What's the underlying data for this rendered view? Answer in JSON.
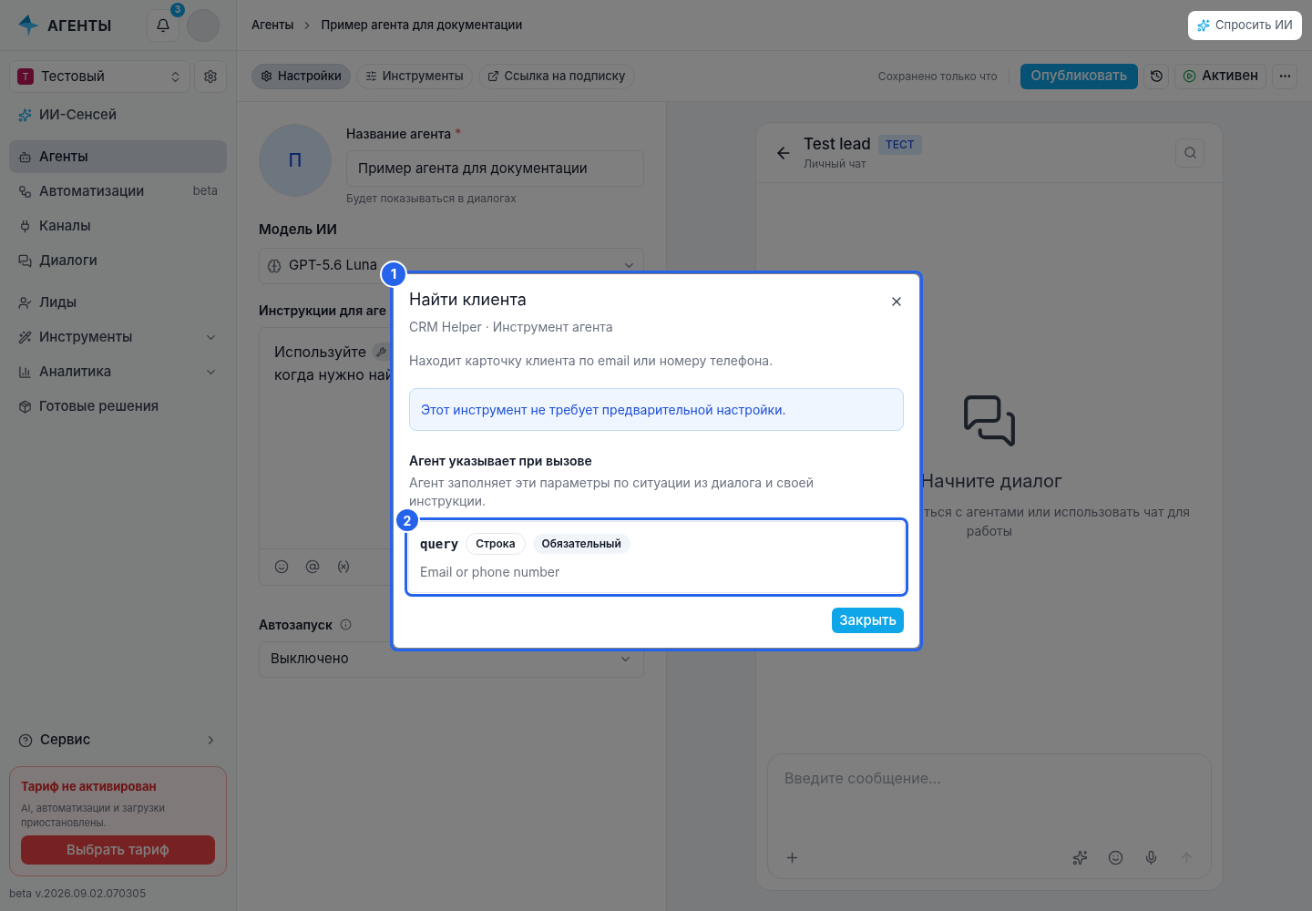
{
  "app": {
    "logo": "АГЕНТЫ",
    "notifications": "3"
  },
  "workspace": {
    "name": "Тестовый",
    "initial": "Т"
  },
  "sidebar": {
    "nav_groups": [
      {
        "items": [
          {
            "label": "ИИ-Сенсей",
            "kind": "ai",
            "selected": false
          }
        ]
      },
      {
        "items": [
          {
            "label": "Агенты",
            "kind": "agents",
            "selected": true
          },
          {
            "label": "Автоматизации",
            "kind": "automations",
            "selected": false,
            "badge": "beta"
          },
          {
            "label": "Каналы",
            "kind": "channels",
            "selected": false
          },
          {
            "label": "Диалоги",
            "kind": "dialogs",
            "selected": false
          }
        ]
      },
      {
        "items": [
          {
            "label": "Лиды",
            "kind": "leads",
            "selected": false
          },
          {
            "label": "Инструменты",
            "kind": "tools",
            "selected": false,
            "expandable": true
          },
          {
            "label": "Аналитика",
            "kind": "analytics",
            "selected": false,
            "expandable": true
          },
          {
            "label": "Готовые решения",
            "kind": "solutions",
            "selected": false
          }
        ]
      }
    ],
    "footer_item": {
      "label": "Сервис"
    },
    "plan_notice": {
      "title": "Тариф не активирован",
      "text": "AI, автоматизации и загрузки приостановлены.",
      "button": "Выбрать тариф"
    },
    "version": "beta v.2026.09.02.070305"
  },
  "header": {
    "breadcrumbs": [
      "Агенты",
      "Пример агента для документации"
    ],
    "ask_ai": "Спросить ИИ"
  },
  "toolbar": {
    "tabs": [
      {
        "label": "Настройки",
        "kind": "settings",
        "selected": true
      },
      {
        "label": "Инструменты",
        "kind": "tools",
        "selected": false
      },
      {
        "label": "Ссылка на подписку",
        "kind": "link",
        "selected": false
      }
    ],
    "save_status": "Сохранено только что",
    "publish": "Опубликовать",
    "status": "Активен"
  },
  "form": {
    "avatar": "П",
    "name_label": "Название агента",
    "required_mark": "*",
    "name_value": "Пример агента для документации",
    "name_hint": "Будет показываться в диалогах",
    "model_label": "Модель ИИ",
    "model_value": "GPT-5.6 Luna",
    "instructions_label": "Инструкции для аге",
    "instructions_lines": [
      "Используйте",
      "когда нужно най"
    ],
    "autostart_label": "Автозапуск",
    "autostart_value": "Выключено"
  },
  "chat": {
    "title": "Test lead",
    "tag": "ТЕСТ",
    "subtitle": "Личный чат",
    "empty_title": "Начните диалог",
    "empty_lines": [
      "ться с агентами или использовать чат для",
      "работы"
    ],
    "composer_placeholder": "Введите сообщение..."
  },
  "modal": {
    "title": "Найти клиента",
    "subtitle": "CRM Helper · Инструмент агента",
    "description": "Находит карточку клиента по email или номеру телефона.",
    "info": "Этот инструмент не требует предварительной настройки.",
    "params_title": "Агент указывает при вызове",
    "params_text": "Агент заполняет эти параметры по ситуации из диалога и своей инструкции.",
    "params": [
      {
        "name": "query",
        "type": "Строка",
        "required_label": "Обязательный",
        "description": "Email or phone number"
      }
    ],
    "close_button": "Закрыть"
  },
  "annotations": [
    {
      "label": "1"
    },
    {
      "label": "2"
    }
  ]
}
